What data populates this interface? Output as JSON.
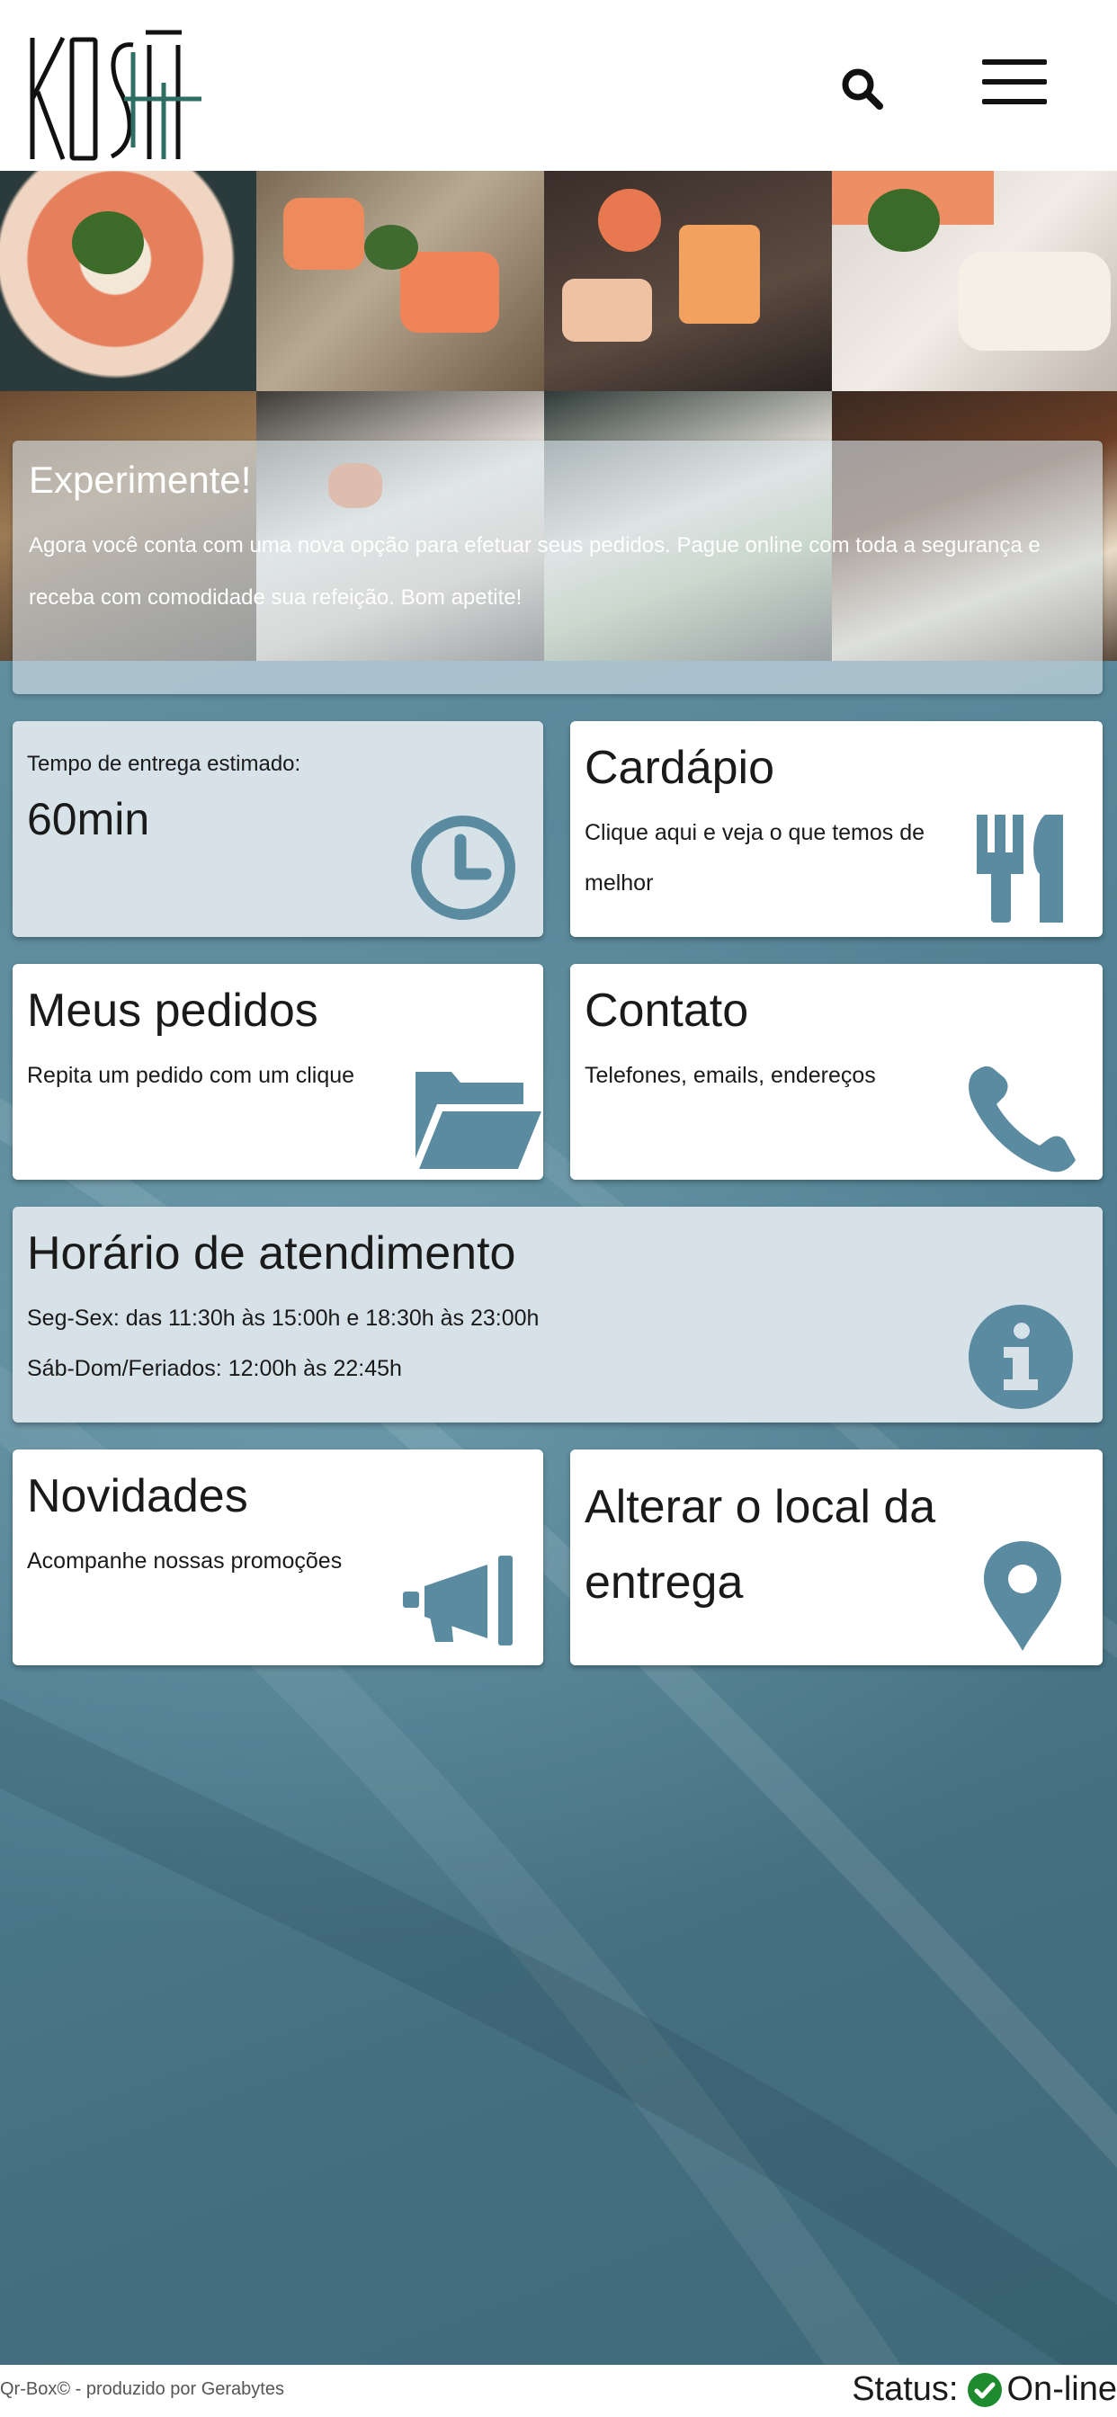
{
  "header": {
    "logo_text": "KOSHŌ",
    "search_icon": "search-icon",
    "menu_icon": "hamburger-menu-icon"
  },
  "promo": {
    "title": "Experimente!",
    "text": "Agora você conta com uma nova opção para efetuar seus pedidos. Pague online com toda a segurança e receba com comodidade sua refeição. Bom apetite!"
  },
  "cards": {
    "delivery": {
      "label": "Tempo de entrega estimado:",
      "value": "60min",
      "icon": "clock-icon"
    },
    "menu": {
      "title": "Cardápio",
      "subtitle": "Clique aqui e veja o que temos de melhor",
      "icon": "fork-knife-icon"
    },
    "orders": {
      "title": "Meus pedidos",
      "subtitle": "Repita um pedido com um clique",
      "icon": "folder-open-icon"
    },
    "contact": {
      "title": "Contato",
      "subtitle": "Telefones, emails, endereços",
      "icon": "phone-icon"
    },
    "hours": {
      "title": "Horário de atendimento",
      "line1": "Seg-Sex: das 11:30h às 15:00h e 18:30h às 23:00h",
      "line2": "Sáb-Dom/Feriados: 12:00h às 22:45h",
      "icon": "info-icon"
    },
    "news": {
      "title": "Novidades",
      "subtitle": "Acompanhe nossas promoções",
      "icon": "megaphone-icon"
    },
    "location": {
      "title": "Alterar o local da entrega",
      "icon": "map-pin-icon"
    }
  },
  "footer": {
    "credit": "Qr-Box© - produzido por Gerabytes",
    "status_label": "Status:",
    "status_value": "On-line",
    "status_icon": "check-circle-icon"
  },
  "colors": {
    "accent": "#5b8ba0",
    "tint_card": "#d6e2e8",
    "background": "#4f7f90",
    "status_green": "#1e8a2e"
  }
}
